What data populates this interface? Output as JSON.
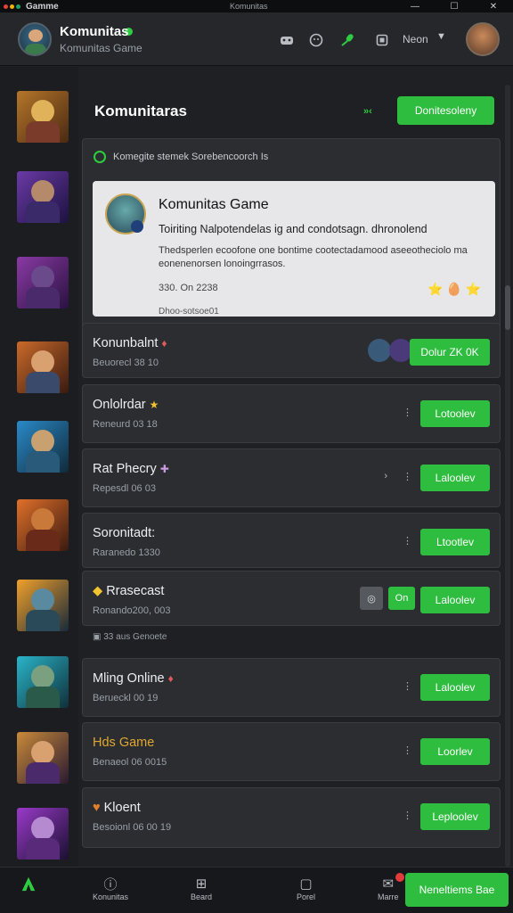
{
  "titlebar": {
    "app_name": "Gamme",
    "window_title": "Komunitas"
  },
  "header": {
    "title": "Komunitas",
    "subtitle": "Komunitas Game",
    "user_label": "Neon",
    "colors": {
      "accent": "#2ebd3f",
      "background": "#1e2024"
    }
  },
  "main": {
    "heading": "Komunitaras",
    "arrows": "»‹",
    "primary_button": "Donitesoleny",
    "notice": "Komegite stemek Sorebencoorch Is"
  },
  "featured": {
    "title": "Komunitas Game",
    "line1": "Toiriting Nalpotendelas ig and condotsagn. dhronolend",
    "description": "Thedsperlen ecoofone one bontime cootectadamood aseeotheciolo ma eonenenorsen lonoingrrasos.",
    "meta": "330. On 2238",
    "meta2": "Dhoo-sotsoe01",
    "stars": "⭐ 🥚 ⭐"
  },
  "games": [
    {
      "name": "Konunbalnt",
      "emoji": "♦",
      "meta": "Beuorecl 38 10",
      "button": "Dolur ZK 0K"
    },
    {
      "name": "Onlolrdar",
      "emoji": "★",
      "meta": "Reneurd 03 18",
      "button": "Lotoolev"
    },
    {
      "name": "Rat Phecry",
      "emoji": "✚",
      "meta": "Repesdl 06 03",
      "button": "Laloolev"
    },
    {
      "name": "Soronitadt:",
      "emoji": "",
      "meta": "Raranedo 1330",
      "button": "Ltootlev"
    },
    {
      "name": "Rrasecast",
      "emoji": "",
      "meta": "Ronando200, 003",
      "button": "Laloolev",
      "extra": "On"
    },
    {
      "name": "Mling Online",
      "emoji": "♦",
      "meta": "Berueckl 00 19",
      "button": "Laloolev"
    },
    {
      "name": "Hds Game",
      "emoji": "",
      "meta": "Benaeol 06 0015",
      "button": "Loorlev"
    },
    {
      "name": "Kloent",
      "emoji": "",
      "meta": "Besoionl 06 00 19",
      "button": "Leploolev"
    }
  ],
  "separator": "33 aus Genoete",
  "bottom_nav": {
    "items": [
      {
        "label": "",
        "icon": "home-icon"
      },
      {
        "label": "Konunitas",
        "icon": "info-icon"
      },
      {
        "label": "Beard",
        "icon": "gamepad-icon"
      },
      {
        "label": "Porel",
        "icon": "panel-icon"
      },
      {
        "label": "Marre",
        "icon": "message-icon"
      }
    ],
    "cta": "Neneltiems Bae"
  }
}
